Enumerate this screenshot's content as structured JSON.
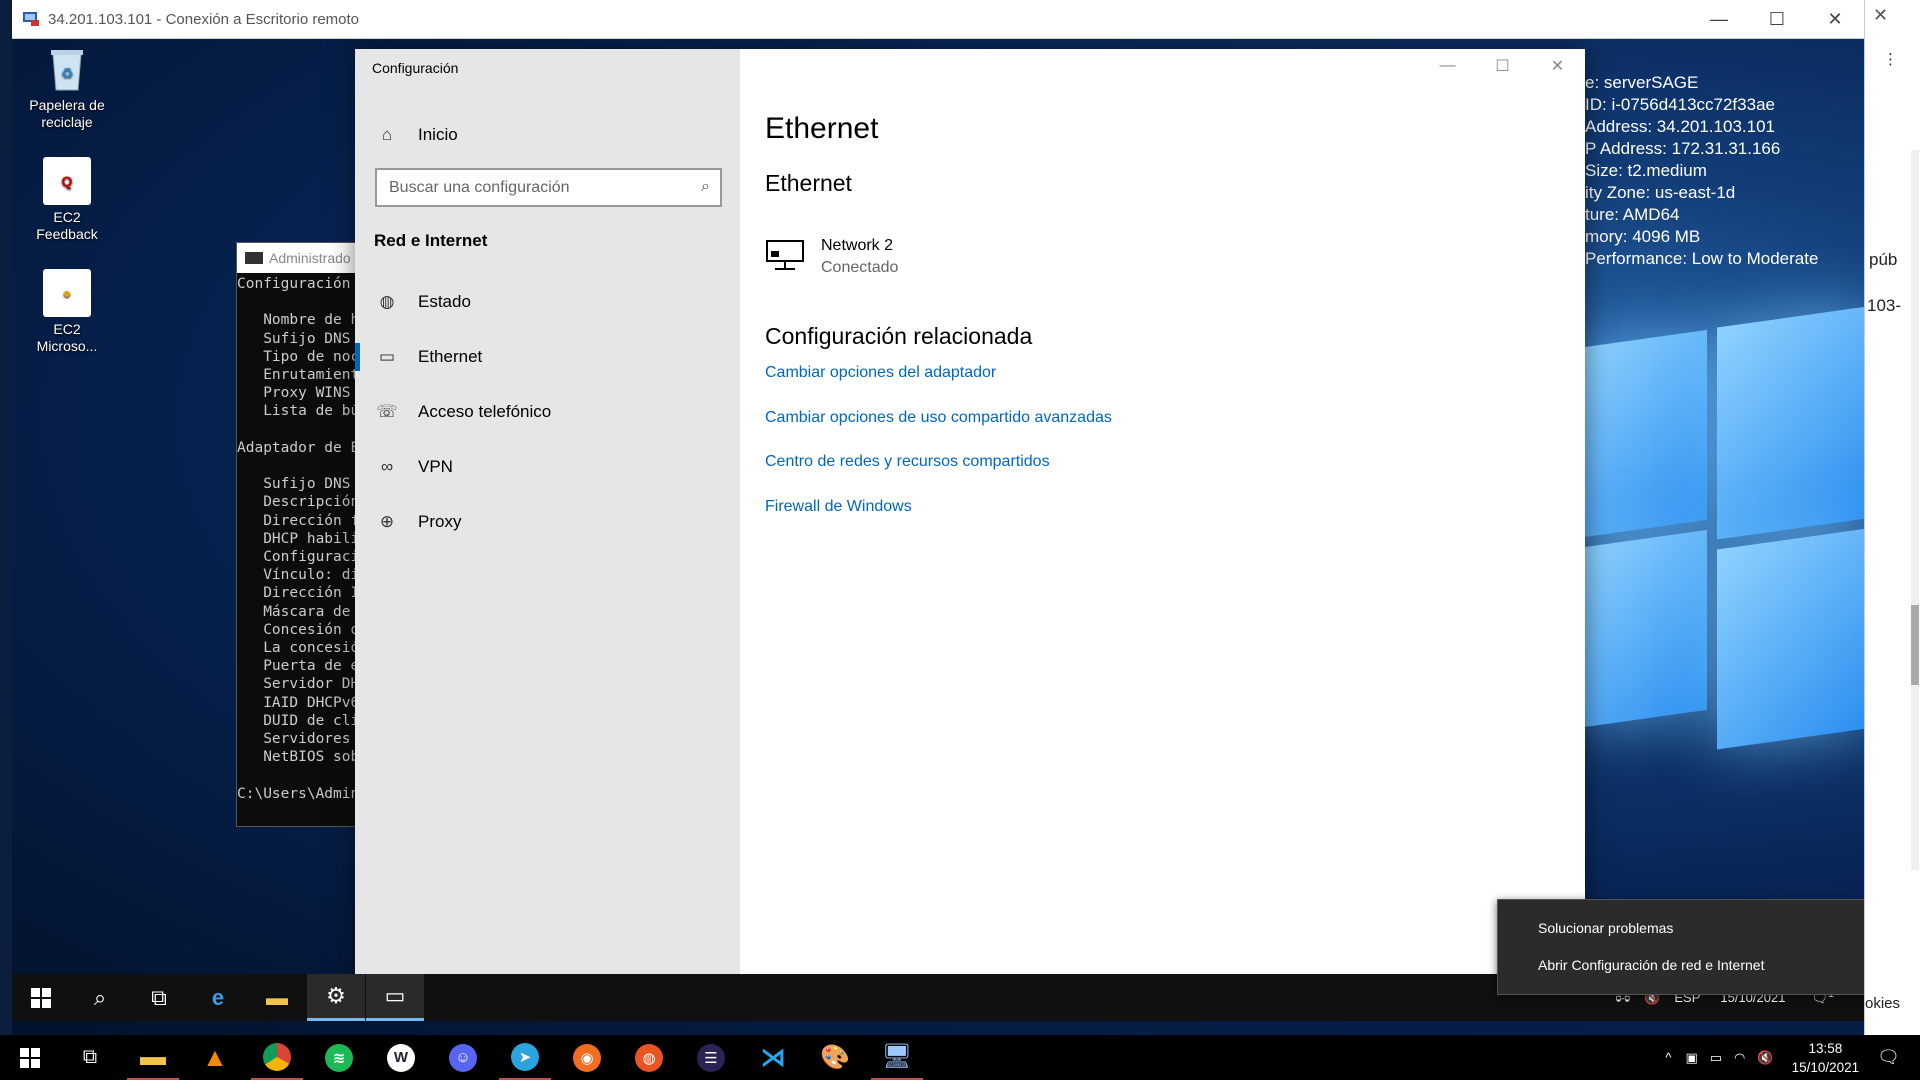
{
  "rdp_window": {
    "title": "34.201.103.101 - Conexión a Escritorio remoto",
    "minimize": "—",
    "maximize": "☐",
    "close": "✕"
  },
  "desktop_icons": [
    {
      "label": "Papelera de reciclaje",
      "icon": "recycle-bin-icon"
    },
    {
      "label": "EC2 Feedback",
      "icon": "ec2-feedback-icon"
    },
    {
      "label": "EC2 Microso...",
      "icon": "ec2-microsoft-icon"
    }
  ],
  "bginfo": {
    "lines": [
      "e: serverSAGE",
      "ID: i-0756d413cc72f33ae",
      "Address: 34.201.103.101",
      "P Address: 172.31.31.166",
      "Size: t2.medium",
      "ity Zone: us-east-1d",
      "ture: AMD64",
      "mory: 4096 MB",
      "Performance: Low to Moderate"
    ]
  },
  "cmd_window": {
    "title": "Administrado",
    "output": "Configuración\n\n   Nombre de h\n   Sufijo DNS \n   Tipo de noc\n   Enrutamient\n   Proxy WINS \n   Lista de bú\n\nAdaptador de E\n\n   Sufijo DNS \n   Descripción\n   Dirección f\n   DHCP habili\n   Configuraci\n   Vínculo: di\n   Dirección I\n   Máscara de \n   Concesión o\n   La concesió\n   Puerta de e\n   Servidor DH\n   IAID DHCPv6\n   DUID de cli\n   Servidores \n   NetBIOS sob\n\nC:\\Users\\Admin"
  },
  "settings": {
    "app_title": "Configuración",
    "home_label": "Inicio",
    "search_placeholder": "Buscar una configuración",
    "section_title": "Red e Internet",
    "nav_items": [
      {
        "label": "Estado",
        "icon": "globe-status-icon"
      },
      {
        "label": "Ethernet",
        "icon": "ethernet-icon",
        "active": true
      },
      {
        "label": "Acceso telefónico",
        "icon": "dial-up-icon"
      },
      {
        "label": "VPN",
        "icon": "vpn-icon"
      },
      {
        "label": "Proxy",
        "icon": "globe-icon"
      }
    ],
    "page_title": "Ethernet",
    "subheading": "Ethernet",
    "network": {
      "name": "Network 2",
      "status": "Conectado"
    },
    "related_title": "Configuración relacionada",
    "links": [
      "Cambiar opciones del adaptador",
      "Cambiar opciones de uso compartido avanzadas",
      "Centro de redes y recursos compartidos",
      "Firewall de Windows"
    ]
  },
  "context_menu": {
    "items": [
      "Solucionar problemas",
      "Abrir Configuración de red e Internet"
    ]
  },
  "inner_tray": {
    "lang": "ESP",
    "date": "15/10/2021",
    "notif_count": "1"
  },
  "right_strip": {
    "pub": "púb",
    "ip_frag": "103-",
    "cookies": "okies"
  },
  "host_tray": {
    "time": "13:58",
    "date": "15/10/2021"
  },
  "colors": {
    "accent": "#0067c0",
    "sidebar_bg": "#e6e6e6"
  }
}
